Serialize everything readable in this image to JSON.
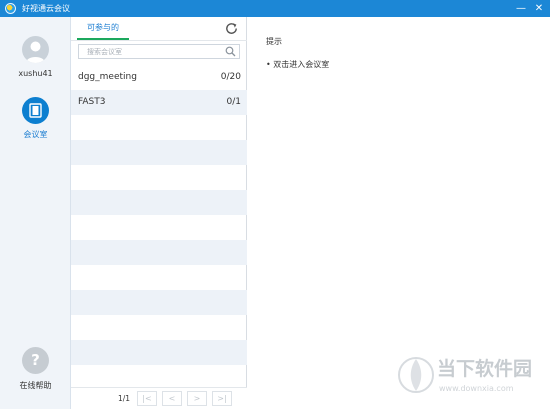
{
  "window": {
    "title": "好视通云会议",
    "minimize_glyph": "—",
    "close_glyph": "✕"
  },
  "sidebar": {
    "username": "xushu41",
    "meeting_room_label": "会议室",
    "help_label": "在线帮助",
    "help_glyph": "?"
  },
  "list_panel": {
    "tab_label": "可参与的",
    "search_placeholder": "搜索会议室",
    "rows": [
      {
        "name": "dgg_meeting",
        "count": "0/20"
      },
      {
        "name": "FAST3",
        "count": "0/1"
      }
    ],
    "pager": {
      "page_info": "1/1",
      "first_glyph": "|<",
      "prev_glyph": "<",
      "next_glyph": ">",
      "last_glyph": ">|"
    }
  },
  "main": {
    "hint_title": "提示",
    "hint_text": "• 双击进入会议室"
  },
  "watermark": {
    "title": "当下软件园",
    "url": "www.downxia.com"
  },
  "colors": {
    "titlebar": "#1c87d6",
    "accent_blue": "#1b7dd1",
    "tab_underline": "#1ca85d",
    "sidebar_bg": "#f0f4f9",
    "row_alt": "#edf2f8"
  },
  "icons": [
    "app-logo",
    "minimize-icon",
    "close-icon",
    "user-avatar-icon",
    "meeting-room-icon",
    "help-icon",
    "refresh-icon",
    "search-icon",
    "watermark-logo"
  ]
}
